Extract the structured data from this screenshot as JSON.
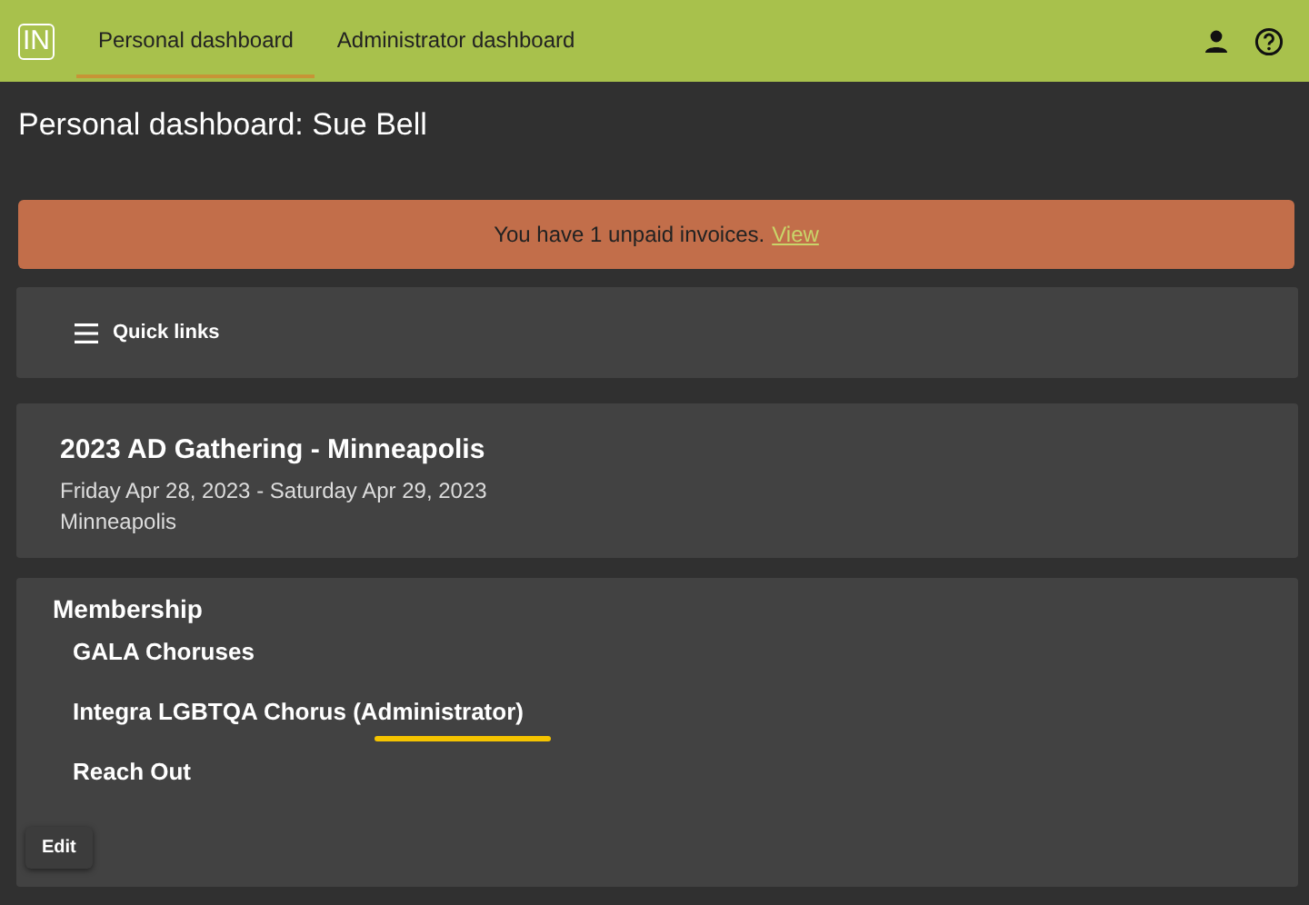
{
  "header": {
    "logo": "IN",
    "tabs": [
      {
        "label": "Personal dashboard",
        "selected": true
      },
      {
        "label": "Administrator dashboard",
        "selected": false
      }
    ]
  },
  "page_title": "Personal dashboard: Sue Bell",
  "alert": {
    "text": "You have 1 unpaid invoices.",
    "link": "View"
  },
  "quick_links": {
    "label": "Quick links"
  },
  "event": {
    "title": "2023 AD Gathering - Minneapolis",
    "dates": "Friday Apr 28, 2023 - Saturday Apr 29, 2023",
    "location": "Minneapolis"
  },
  "membership": {
    "title": "Membership",
    "items": [
      {
        "name": "GALA Choruses",
        "highlighted": false
      },
      {
        "name": "Integra LGBTQA Chorus (Administrator)",
        "highlighted": true
      },
      {
        "name": "Reach Out",
        "highlighted": false
      }
    ],
    "button": "Edit"
  }
}
